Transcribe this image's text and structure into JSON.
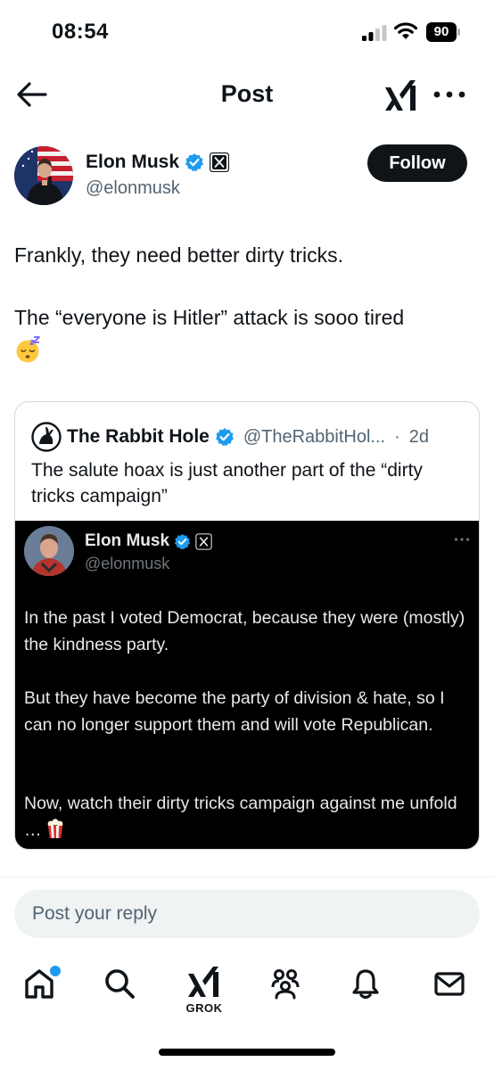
{
  "status_bar": {
    "time": "08:54",
    "battery": "90"
  },
  "nav": {
    "title": "Post"
  },
  "author": {
    "name": "Elon Musk",
    "handle": "@elonmusk",
    "follow_label": "Follow"
  },
  "post": {
    "line1": "Frankly, they need better dirty tricks.",
    "line2": "The “everyone is Hitler” attack is sooo tired",
    "emoji": "sleeping-face-emoji"
  },
  "quote": {
    "name": "The Rabbit Hole",
    "handle": "@TheRabbitHol...",
    "separator": "·",
    "time": "2d",
    "text": "The salute hoax is just another part of the “dirty tricks campaign”",
    "embed": {
      "name": "Elon Musk",
      "handle": "@elonmusk",
      "p1": "In the past I voted Democrat, because they were (mostly) the kindness party.",
      "p2": "But they have become the party of division & hate, so I can no longer support them and will vote Republican.",
      "p3": "Now, watch their dirty tricks campaign against me unfold …"
    }
  },
  "reply": {
    "placeholder": "Post your reply"
  },
  "tabs": {
    "grok_label": "GROK"
  },
  "colors": {
    "accent": "#1d9bf0",
    "text": "#0f1419",
    "muted": "#536471",
    "border": "#cfd9de"
  }
}
